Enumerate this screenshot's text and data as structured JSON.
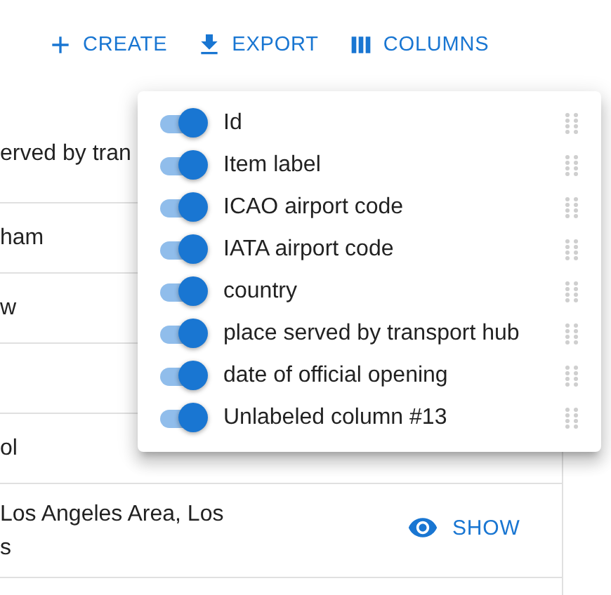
{
  "toolbar": [
    {
      "label": "CREATE"
    },
    {
      "label": "EXPORT"
    },
    {
      "label": "COLUMNS"
    }
  ],
  "table": {
    "header": "erved by tran",
    "rows": [
      {
        "kind": "text",
        "lines": [
          "ham"
        ]
      },
      {
        "kind": "text",
        "lines": [
          "w"
        ]
      },
      {
        "kind": "blank"
      },
      {
        "kind": "text",
        "lines": [
          "ol"
        ]
      },
      {
        "kind": "text",
        "lines": [
          "Los Angeles Area, Los",
          "s"
        ],
        "action": "SHOW"
      },
      {
        "kind": "blank"
      }
    ]
  },
  "columns_panel": {
    "columns": [
      {
        "label": "Id",
        "on": true
      },
      {
        "label": "Item label",
        "on": true
      },
      {
        "label": "ICAO airport code",
        "on": true
      },
      {
        "label": "IATA airport code",
        "on": true
      },
      {
        "label": "country",
        "on": true
      },
      {
        "label": "place served by transport hub",
        "on": true
      },
      {
        "label": "date of official opening",
        "on": true
      },
      {
        "label": "Unlabeled column #13",
        "on": true
      }
    ]
  }
}
